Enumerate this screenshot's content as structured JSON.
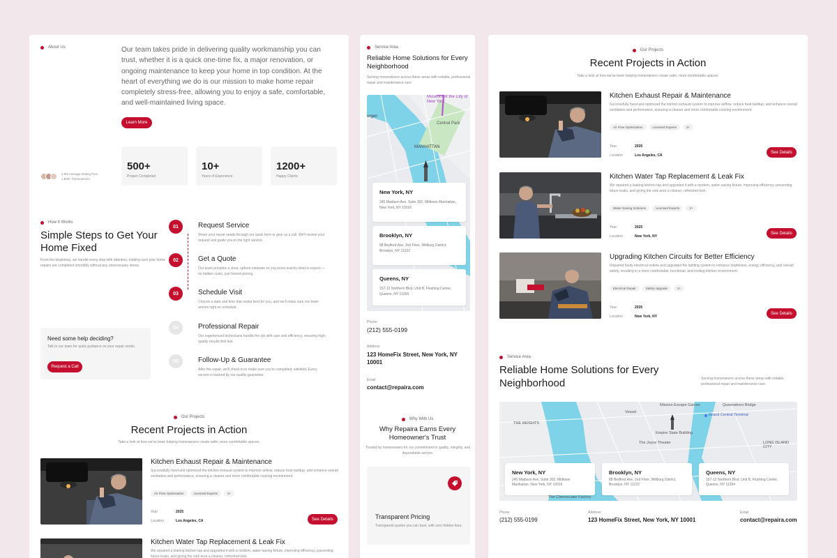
{
  "colors": {
    "accent": "#c4102e",
    "background": "#f2e8ec"
  },
  "about": {
    "tag": "About Us",
    "body": "Our team takes pride in delivering quality workmanship you can trust, whether it is a quick one-time fix, a major renovation, or ongoing maintenance to keep your home in top condition. At the heart of everything we do is our mission to make home repair completely stress-free, allowing you to enjoy a safe, comfortable, and well-maintained living space.",
    "button": "Learn More",
    "rating_line1": "4.9/5 Average Rating from",
    "rating_line2": "1,500+ homeowners",
    "stats": [
      {
        "value": "500+",
        "label": "Project Completed"
      },
      {
        "value": "10+",
        "label": "Years of Experience"
      },
      {
        "value": "1200+",
        "label": "Happy Clients"
      }
    ]
  },
  "how": {
    "tag": "How It Works",
    "title": "Simple Steps to Get Your Home Fixed",
    "desc": "From the beginning, we handle every step with attention, making sure your home repairs are completed smoothly without any unnecessary stress.",
    "help_title": "Need some help deciding?",
    "help_desc": "Talk to our team for quick guidance on your repair needs.",
    "help_button": "Request a Call",
    "steps": [
      {
        "num": "01",
        "title": "Request Service",
        "desc": "Share your repair needs through our quick form or give us a call. We'll review your request and guide you to the right service."
      },
      {
        "num": "02",
        "title": "Get a Quote",
        "desc": "Our team provides a clear, upfront estimate so you know exactly what to expect — no hidden costs, just honest pricing."
      },
      {
        "num": "03",
        "title": "Schedule Visit",
        "desc": "Choose a date and time that works best for you, and we'll make sure our team arrives right on schedule."
      },
      {
        "num": "04",
        "title": "Professional Repair",
        "desc": "Our experienced technicians handle the job with care and efficiency, ensuring high-quality results that last."
      },
      {
        "num": "05",
        "title": "Follow-Up & Guarantee",
        "desc": "After the repair, we'll check in to make sure you're completely satisfied. Every service is backed by our quality guarantee."
      }
    ]
  },
  "projects": {
    "tag": "Our Projects",
    "title": "Recent Projects in Action",
    "subtitle": "Take a look at how we've been helping homeowners create safer, more comfortable spaces.",
    "year_label": "Year",
    "location_label": "Location",
    "button": "See Details",
    "items": [
      {
        "title": "Kitchen Exhaust Repair & Maintenance",
        "desc": "Successfully fixed and optimized the kitchen exhaust system to improve airflow, reduce heat buildup, and enhance overall ventilation and performance, ensuring a cleaner and more comfortable cooking environment.",
        "tags": [
          "Air Flow Optimization",
          "Licensed Experts",
          "2+"
        ],
        "year": "2035",
        "location": "Los Angeles, CA"
      },
      {
        "title": "Kitchen Water Tap Replacement & Leak Fix",
        "desc": "We repaired a leaking kitchen tap and upgraded it with a modern, water-saving fixture, improving efficiency, preventing future leaks, and giving the sink area a cleaner, refreshed look.",
        "tags": [
          "Water-Saving Solutions",
          "Licensed Experts",
          "2+"
        ],
        "year": "2025",
        "location": "New York, NY"
      },
      {
        "title": "Upgrading Kitchen Circuits for Better Efficiency",
        "desc": "Repaired faulty electrical outlets and upgraded the lighting system to enhance brightness, energy efficiency, and overall safety, resulting in a more comfortable, functional, and inviting kitchen environment.",
        "tags": [
          "Electrical Repair",
          "Safety Upgrade",
          "2+"
        ],
        "year": "2035",
        "location": "New York, NY"
      }
    ]
  },
  "service": {
    "tag": "Service Area",
    "title": "Reliable Home Solutions for Every Neighborhood",
    "desc": "Serving homeowners across these areas with reliable, professional repair and maintenance care.",
    "locations": [
      {
        "city": "New York, NY",
        "address": "245 Madison Ave, Suite 302, Midtown Manhattan, New York, NY 10016"
      },
      {
        "city": "Brooklyn, NY",
        "address": "88 Bedford Ave, 2nd Floor, Willburg District, Brooklyn, NY 11222"
      },
      {
        "city": "Queens, NY",
        "address": "157-12 Northern Blvd, Unit B, Flushing Center, Queens, NY 11354"
      }
    ],
    "phone_label": "Phone",
    "phone": "(212) 555-0199",
    "address_label": "Address",
    "address": "123 HomeFix Street, New York, NY 10001",
    "email_label": "Email",
    "email": "contact@repaira.com",
    "map_labels": [
      "Museum of the City of New York",
      "Central Park",
      "MANHATTAN",
      "ergen",
      "Mission Escape Games",
      "Queensboro Bridge",
      "THE HEIGHTS",
      "Grand Central Terminal",
      "Empire State Building",
      "The Joyce Theater",
      "LONG ISLAND CITY",
      "The Cheesecake Factory",
      "Vessel"
    ]
  },
  "why": {
    "tag": "Why With Us",
    "title": "Why Repaira Earns Every Homeowner's Trust",
    "desc": "Trusted by homeowners for our commitment to quality, integrity, and dependable service.",
    "card_title": "Transparent Pricing",
    "card_desc": "Transparent quotes you can trust, with zero hidden fees.",
    "card_icon": "price-tag-icon"
  }
}
